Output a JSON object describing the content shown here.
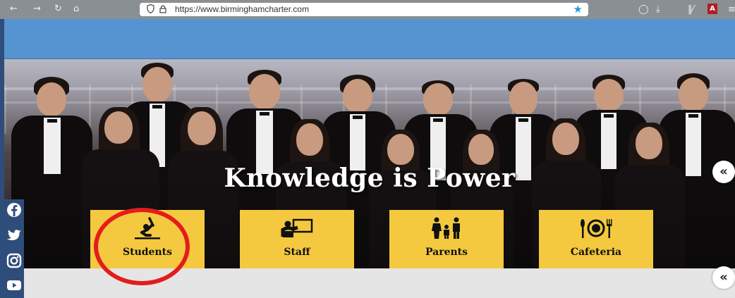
{
  "browser": {
    "url": "https://www.birminghamcharter.com",
    "icons": [
      "back-icon",
      "forward-icon",
      "reload-icon",
      "home-icon",
      "shield-icon",
      "lock-icon",
      "bookmark-star-icon",
      "pocket-icon",
      "download-icon",
      "library-icon",
      "pdf-icon",
      "menu-icon"
    ]
  },
  "hero": {
    "tagline": "Knowledge is Power"
  },
  "tiles": [
    {
      "label": "Students",
      "icon": "student-raising-hand-icon"
    },
    {
      "label": "Staff",
      "icon": "teacher-board-icon"
    },
    {
      "label": "Parents",
      "icon": "family-icon"
    },
    {
      "label": "Cafeteria",
      "icon": "plate-utensils-icon"
    }
  ],
  "social": [
    "facebook-icon",
    "twitter-icon",
    "instagram-icon",
    "youtube-icon"
  ],
  "collapse_buttons": {
    "label": "«"
  },
  "colors": {
    "header_blue": "#5694d1",
    "tile_yellow": "#f5c93f",
    "highlight_red": "#e41c1c",
    "sidebar_navy": "#2f4d7a"
  }
}
